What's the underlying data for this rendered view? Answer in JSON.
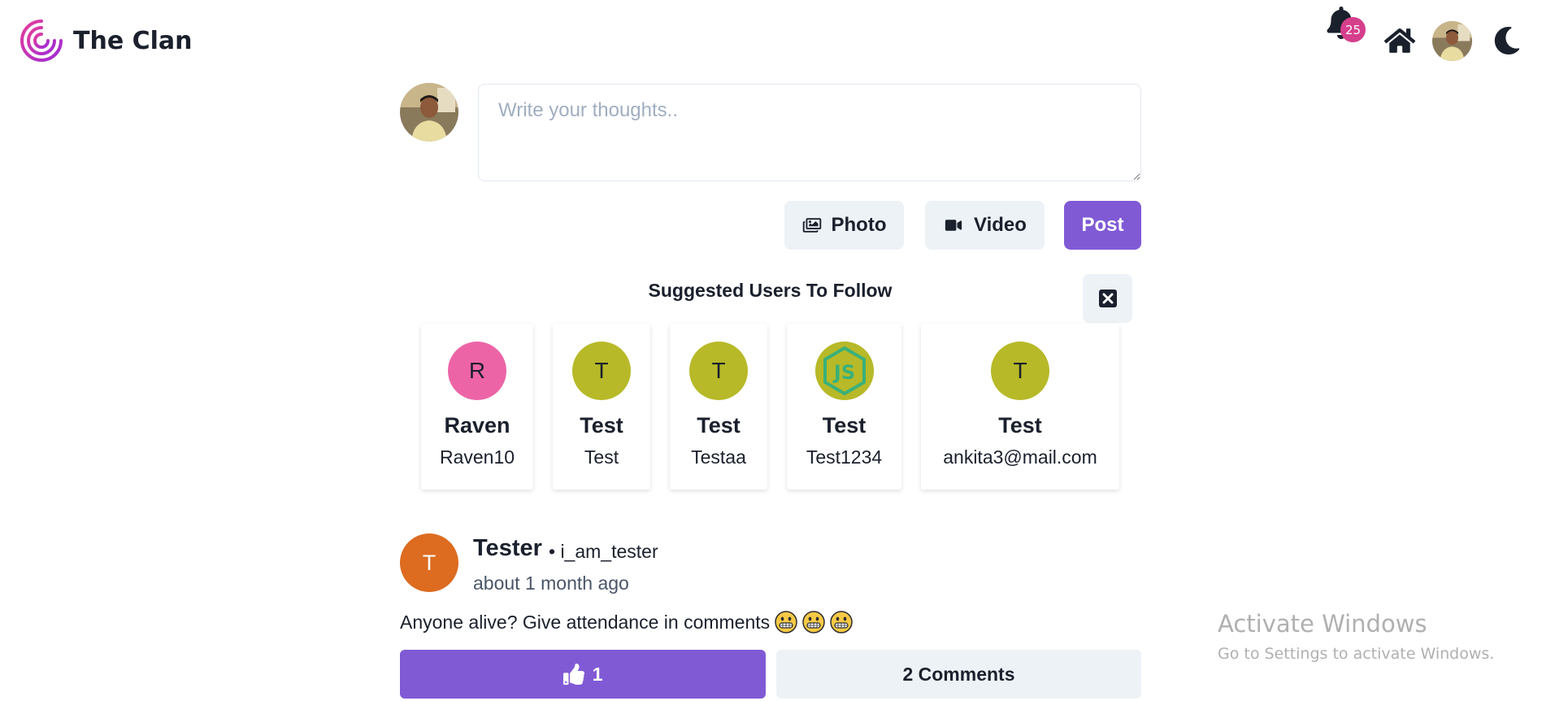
{
  "header": {
    "brand": "The Clan",
    "notification_count": "25"
  },
  "composer": {
    "placeholder": "Write your thoughts..",
    "photo_label": "Photo",
    "video_label": "Video",
    "post_label": "Post"
  },
  "suggested": {
    "title": "Suggested Users To Follow",
    "users": [
      {
        "initial": "R",
        "name": "Raven",
        "username": "Raven10",
        "color": "#ed64a6"
      },
      {
        "initial": "T",
        "name": "Test",
        "username": "Test",
        "color": "#b7b928"
      },
      {
        "initial": "T",
        "name": "Test",
        "username": "Testaa",
        "color": "#b7b928"
      },
      {
        "initial": "",
        "name": "Test",
        "username": "Test1234",
        "color": "#b7b928",
        "icon": "nodejs-logo"
      },
      {
        "initial": "T",
        "name": "Test",
        "username": "ankita3@mail.com",
        "color": "#b7b928"
      }
    ]
  },
  "post": {
    "avatar_initial": "T",
    "author": "Tester",
    "handle": "• i_am_tester",
    "time": "about 1 month ago",
    "text": "Anyone alive? Give attendance in comments",
    "emojis": [
      "grinning-face",
      "grinning-face",
      "grinning-face"
    ],
    "likes": "1",
    "comments_label": "2 Comments"
  },
  "watermark": {
    "title": "Activate Windows",
    "subtitle": "Go to Settings to activate Windows."
  },
  "colors": {
    "accent": "#805ad5",
    "badge": "#d53f8c",
    "post_avatar": "#dd6b20",
    "button_gray": "#edf2f7"
  }
}
